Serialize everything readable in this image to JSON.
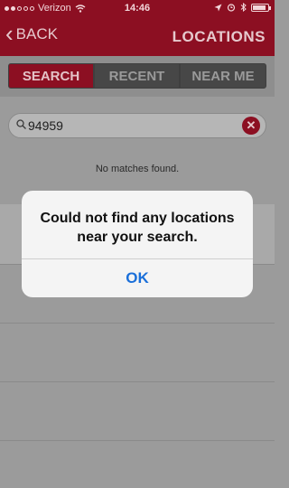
{
  "status": {
    "carrier": "Verizon",
    "time": "14:46"
  },
  "nav": {
    "back_label": "BACK",
    "title": "LOCATIONS"
  },
  "tabs": [
    {
      "label": "SEARCH",
      "active": true
    },
    {
      "label": "RECENT",
      "active": false
    },
    {
      "label": "NEAR ME",
      "active": false
    }
  ],
  "search": {
    "value": "94959"
  },
  "results": {
    "empty_message": "No matches found."
  },
  "alert": {
    "message": "Could not find any locations near your search.",
    "button_label": "OK"
  },
  "colors": {
    "brand": "#8c0f22",
    "alert_button": "#1a6fd9"
  }
}
